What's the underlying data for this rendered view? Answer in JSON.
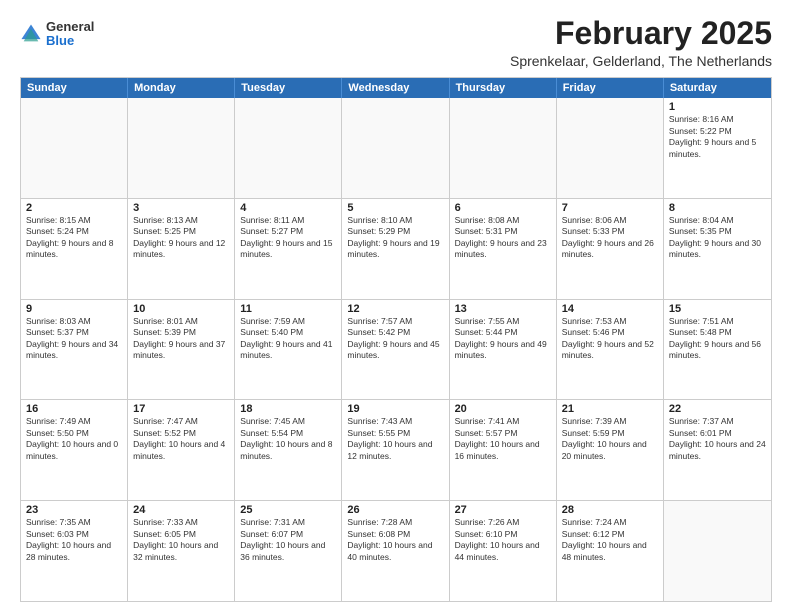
{
  "logo": {
    "general": "General",
    "blue": "Blue"
  },
  "title": "February 2025",
  "subtitle": "Sprenkelaar, Gelderland, The Netherlands",
  "header_days": [
    "Sunday",
    "Monday",
    "Tuesday",
    "Wednesday",
    "Thursday",
    "Friday",
    "Saturday"
  ],
  "rows": [
    [
      {
        "day": "",
        "text": ""
      },
      {
        "day": "",
        "text": ""
      },
      {
        "day": "",
        "text": ""
      },
      {
        "day": "",
        "text": ""
      },
      {
        "day": "",
        "text": ""
      },
      {
        "day": "",
        "text": ""
      },
      {
        "day": "1",
        "text": "Sunrise: 8:16 AM\nSunset: 5:22 PM\nDaylight: 9 hours and 5 minutes."
      }
    ],
    [
      {
        "day": "2",
        "text": "Sunrise: 8:15 AM\nSunset: 5:24 PM\nDaylight: 9 hours and 8 minutes."
      },
      {
        "day": "3",
        "text": "Sunrise: 8:13 AM\nSunset: 5:25 PM\nDaylight: 9 hours and 12 minutes."
      },
      {
        "day": "4",
        "text": "Sunrise: 8:11 AM\nSunset: 5:27 PM\nDaylight: 9 hours and 15 minutes."
      },
      {
        "day": "5",
        "text": "Sunrise: 8:10 AM\nSunset: 5:29 PM\nDaylight: 9 hours and 19 minutes."
      },
      {
        "day": "6",
        "text": "Sunrise: 8:08 AM\nSunset: 5:31 PM\nDaylight: 9 hours and 23 minutes."
      },
      {
        "day": "7",
        "text": "Sunrise: 8:06 AM\nSunset: 5:33 PM\nDaylight: 9 hours and 26 minutes."
      },
      {
        "day": "8",
        "text": "Sunrise: 8:04 AM\nSunset: 5:35 PM\nDaylight: 9 hours and 30 minutes."
      }
    ],
    [
      {
        "day": "9",
        "text": "Sunrise: 8:03 AM\nSunset: 5:37 PM\nDaylight: 9 hours and 34 minutes."
      },
      {
        "day": "10",
        "text": "Sunrise: 8:01 AM\nSunset: 5:39 PM\nDaylight: 9 hours and 37 minutes."
      },
      {
        "day": "11",
        "text": "Sunrise: 7:59 AM\nSunset: 5:40 PM\nDaylight: 9 hours and 41 minutes."
      },
      {
        "day": "12",
        "text": "Sunrise: 7:57 AM\nSunset: 5:42 PM\nDaylight: 9 hours and 45 minutes."
      },
      {
        "day": "13",
        "text": "Sunrise: 7:55 AM\nSunset: 5:44 PM\nDaylight: 9 hours and 49 minutes."
      },
      {
        "day": "14",
        "text": "Sunrise: 7:53 AM\nSunset: 5:46 PM\nDaylight: 9 hours and 52 minutes."
      },
      {
        "day": "15",
        "text": "Sunrise: 7:51 AM\nSunset: 5:48 PM\nDaylight: 9 hours and 56 minutes."
      }
    ],
    [
      {
        "day": "16",
        "text": "Sunrise: 7:49 AM\nSunset: 5:50 PM\nDaylight: 10 hours and 0 minutes."
      },
      {
        "day": "17",
        "text": "Sunrise: 7:47 AM\nSunset: 5:52 PM\nDaylight: 10 hours and 4 minutes."
      },
      {
        "day": "18",
        "text": "Sunrise: 7:45 AM\nSunset: 5:54 PM\nDaylight: 10 hours and 8 minutes."
      },
      {
        "day": "19",
        "text": "Sunrise: 7:43 AM\nSunset: 5:55 PM\nDaylight: 10 hours and 12 minutes."
      },
      {
        "day": "20",
        "text": "Sunrise: 7:41 AM\nSunset: 5:57 PM\nDaylight: 10 hours and 16 minutes."
      },
      {
        "day": "21",
        "text": "Sunrise: 7:39 AM\nSunset: 5:59 PM\nDaylight: 10 hours and 20 minutes."
      },
      {
        "day": "22",
        "text": "Sunrise: 7:37 AM\nSunset: 6:01 PM\nDaylight: 10 hours and 24 minutes."
      }
    ],
    [
      {
        "day": "23",
        "text": "Sunrise: 7:35 AM\nSunset: 6:03 PM\nDaylight: 10 hours and 28 minutes."
      },
      {
        "day": "24",
        "text": "Sunrise: 7:33 AM\nSunset: 6:05 PM\nDaylight: 10 hours and 32 minutes."
      },
      {
        "day": "25",
        "text": "Sunrise: 7:31 AM\nSunset: 6:07 PM\nDaylight: 10 hours and 36 minutes."
      },
      {
        "day": "26",
        "text": "Sunrise: 7:28 AM\nSunset: 6:08 PM\nDaylight: 10 hours and 40 minutes."
      },
      {
        "day": "27",
        "text": "Sunrise: 7:26 AM\nSunset: 6:10 PM\nDaylight: 10 hours and 44 minutes."
      },
      {
        "day": "28",
        "text": "Sunrise: 7:24 AM\nSunset: 6:12 PM\nDaylight: 10 hours and 48 minutes."
      },
      {
        "day": "",
        "text": ""
      }
    ]
  ]
}
